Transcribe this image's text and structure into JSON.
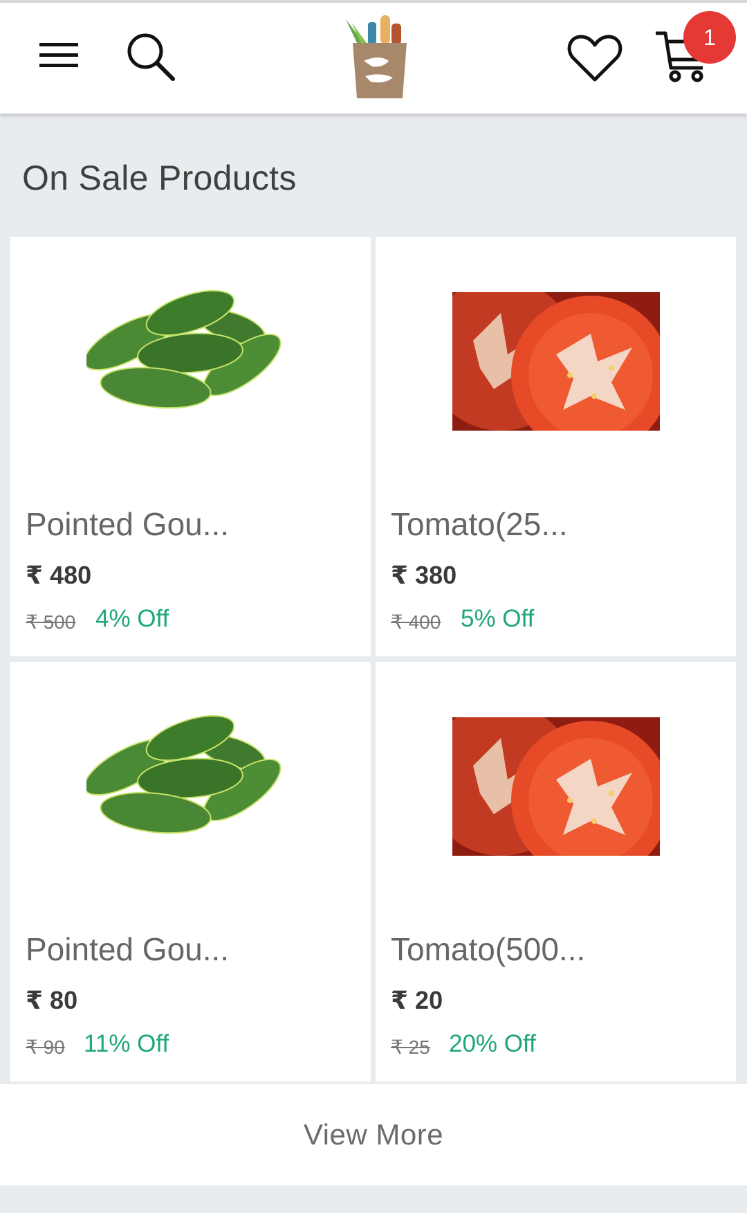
{
  "header": {
    "cart_count": "1"
  },
  "section": {
    "title": "On Sale Products"
  },
  "products": [
    {
      "name": "Pointed Gou...",
      "price": "₹ 480",
      "original_price": "₹ 500",
      "discount": "4% Off",
      "image": "pointed-gourd"
    },
    {
      "name": "Tomato(25...",
      "price": "₹ 380",
      "original_price": "₹ 400",
      "discount": "5% Off",
      "image": "tomato"
    },
    {
      "name": "Pointed Gou...",
      "price": "₹ 80",
      "original_price": "₹ 90",
      "discount": "11% Off",
      "image": "pointed-gourd"
    },
    {
      "name": "Tomato(500...",
      "price": "₹ 20",
      "original_price": "₹ 25",
      "discount": "20% Off",
      "image": "tomato"
    }
  ],
  "view_more_label": "View More",
  "colors": {
    "discount": "#1fa774",
    "badge": "#e53935",
    "background": "#e9ecef"
  }
}
